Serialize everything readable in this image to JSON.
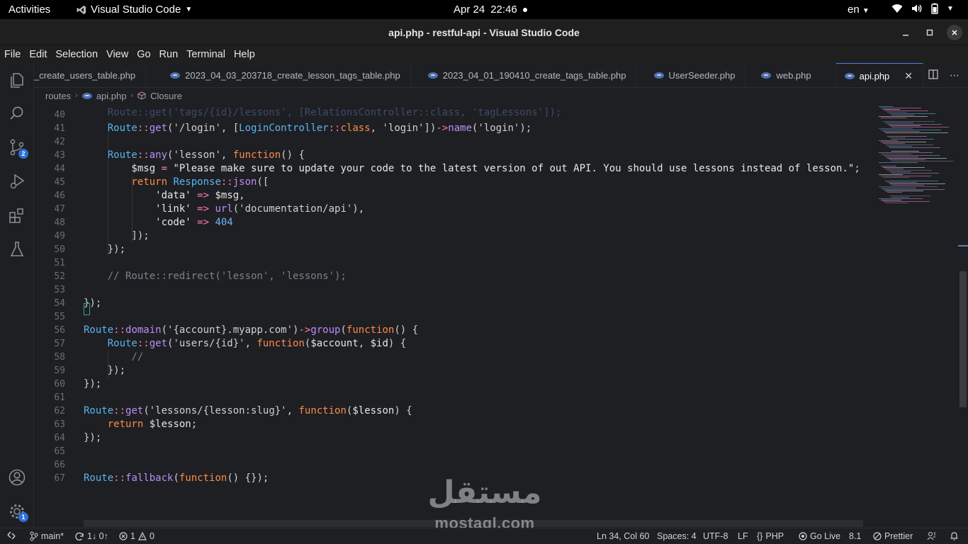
{
  "topbar": {
    "activities": "Activities",
    "app_name": "Visual Studio Code",
    "date": "Apr 24",
    "time": "22:46",
    "lang": "en"
  },
  "window": {
    "title": "api.php - restful-api - Visual Studio Code"
  },
  "menu": [
    "File",
    "Edit",
    "Selection",
    "View",
    "Go",
    "Run",
    "Terminal",
    "Help"
  ],
  "tabs": [
    {
      "label": "_create_users_table.php",
      "active": false,
      "icon": false
    },
    {
      "label": "2023_04_03_203718_create_lesson_tags_table.php",
      "active": false,
      "icon": true
    },
    {
      "label": "2023_04_01_190410_create_tags_table.php",
      "active": false,
      "icon": true
    },
    {
      "label": "UserSeeder.php",
      "active": false,
      "icon": true
    },
    {
      "label": "web.php",
      "active": false,
      "icon": true
    },
    {
      "label": "api.php",
      "active": true,
      "icon": true
    }
  ],
  "breadcrumb": {
    "folder": "routes",
    "file": "api.php",
    "symbol": "Closure"
  },
  "activity_badges": {
    "source_control": "2",
    "settings": "1"
  },
  "code_lines": [
    {
      "n": "40",
      "tokens": []
    },
    {
      "n": "41",
      "tokens": [
        [
          "t-class",
          "    Route"
        ],
        [
          "t-op",
          "::"
        ],
        [
          "t-fn",
          "get"
        ],
        [
          "t-p",
          "('/login', ["
        ],
        [
          "t-class",
          "LoginController"
        ],
        [
          "t-op",
          "::"
        ],
        [
          "t-kw",
          "class"
        ],
        [
          "t-p",
          ", 'login'])"
        ],
        [
          "t-op",
          "->"
        ],
        [
          "t-fn",
          "name"
        ],
        [
          "t-p",
          "('login');"
        ]
      ]
    },
    {
      "n": "42",
      "tokens": []
    },
    {
      "n": "43",
      "tokens": [
        [
          "t-class",
          "    Route"
        ],
        [
          "t-op",
          "::"
        ],
        [
          "t-fn",
          "any"
        ],
        [
          "t-p",
          "('lesson', "
        ],
        [
          "t-kw",
          "function"
        ],
        [
          "t-p",
          "() {"
        ]
      ]
    },
    {
      "n": "44",
      "tokens": [
        [
          "t-var",
          "        $msg "
        ],
        [
          "t-op",
          "="
        ],
        [
          "t-str",
          " \"Please make sure to update your code to the latest version of out API. You should use lessons instead of lesson.\""
        ],
        [
          "t-p",
          ";"
        ]
      ]
    },
    {
      "n": "45",
      "tokens": [
        [
          "t-kw",
          "        return "
        ],
        [
          "t-class",
          "Response"
        ],
        [
          "t-op",
          "::"
        ],
        [
          "t-fn",
          "json"
        ],
        [
          "t-p",
          "(["
        ]
      ]
    },
    {
      "n": "46",
      "tokens": [
        [
          "t-str",
          "            'data' "
        ],
        [
          "t-op",
          "=>"
        ],
        [
          "t-var",
          " $msg"
        ],
        [
          "t-p",
          ","
        ]
      ]
    },
    {
      "n": "47",
      "tokens": [
        [
          "t-str",
          "            'link' "
        ],
        [
          "t-op",
          "=>"
        ],
        [
          "t-fn",
          " url"
        ],
        [
          "t-p",
          "('documentation/api'),"
        ]
      ]
    },
    {
      "n": "48",
      "tokens": [
        [
          "t-str",
          "            'code' "
        ],
        [
          "t-op",
          "=>"
        ],
        [
          "t-num",
          " 404"
        ]
      ]
    },
    {
      "n": "49",
      "tokens": [
        [
          "t-p",
          "        ]);"
        ]
      ]
    },
    {
      "n": "50",
      "tokens": [
        [
          "t-p",
          "    });"
        ]
      ]
    },
    {
      "n": "51",
      "tokens": []
    },
    {
      "n": "52",
      "tokens": [
        [
          "t-cm",
          "    // Route::redirect('lesson', 'lessons');"
        ]
      ]
    },
    {
      "n": "53",
      "tokens": []
    },
    {
      "n": "54",
      "tokens": [
        [
          "t-p",
          "});"
        ]
      ]
    },
    {
      "n": "55",
      "tokens": []
    },
    {
      "n": "56",
      "tokens": [
        [
          "t-class",
          "Route"
        ],
        [
          "t-op",
          "::"
        ],
        [
          "t-fn",
          "domain"
        ],
        [
          "t-p",
          "('{account}.myapp.com')"
        ],
        [
          "t-op",
          "->"
        ],
        [
          "t-fn",
          "group"
        ],
        [
          "t-p",
          "("
        ],
        [
          "t-kw",
          "function"
        ],
        [
          "t-p",
          "() {"
        ]
      ]
    },
    {
      "n": "57",
      "tokens": [
        [
          "t-class",
          "    Route"
        ],
        [
          "t-op",
          "::"
        ],
        [
          "t-fn",
          "get"
        ],
        [
          "t-p",
          "('users/{id}', "
        ],
        [
          "t-kw",
          "function"
        ],
        [
          "t-p",
          "("
        ],
        [
          "t-var",
          "$account"
        ],
        [
          "t-p",
          ", "
        ],
        [
          "t-var",
          "$id"
        ],
        [
          "t-p",
          ") {"
        ]
      ]
    },
    {
      "n": "58",
      "tokens": [
        [
          "t-cm",
          "        //"
        ]
      ]
    },
    {
      "n": "59",
      "tokens": [
        [
          "t-p",
          "    });"
        ]
      ]
    },
    {
      "n": "60",
      "tokens": [
        [
          "t-p",
          "});"
        ]
      ]
    },
    {
      "n": "61",
      "tokens": []
    },
    {
      "n": "62",
      "tokens": [
        [
          "t-class",
          "Route"
        ],
        [
          "t-op",
          "::"
        ],
        [
          "t-fn",
          "get"
        ],
        [
          "t-p",
          "('lessons/{lesson:slug}', "
        ],
        [
          "t-kw",
          "function"
        ],
        [
          "t-p",
          "("
        ],
        [
          "t-var",
          "$lesson"
        ],
        [
          "t-p",
          ") {"
        ]
      ]
    },
    {
      "n": "63",
      "tokens": [
        [
          "t-kw",
          "    return "
        ],
        [
          "t-var",
          "$lesson"
        ],
        [
          "t-p",
          ";"
        ]
      ]
    },
    {
      "n": "64",
      "tokens": [
        [
          "t-p",
          "});"
        ]
      ]
    },
    {
      "n": "65",
      "tokens": []
    },
    {
      "n": "66",
      "tokens": []
    },
    {
      "n": "67",
      "tokens": [
        [
          "t-class",
          "Route"
        ],
        [
          "t-op",
          "::"
        ],
        [
          "t-fn",
          "fallback"
        ],
        [
          "t-p",
          "("
        ],
        [
          "t-kw",
          "function"
        ],
        [
          "t-p",
          "() {});"
        ]
      ]
    }
  ],
  "watermark": {
    "arabic": "مستقل",
    "latin": "mostaql.com"
  },
  "statusbar": {
    "branch": "main*",
    "sync": "1↓ 0↑",
    "errors": "1",
    "warnings": "0",
    "position": "Ln 34, Col 60",
    "spaces": "Spaces: 4",
    "encoding": "UTF-8",
    "eol": "LF",
    "language": "PHP",
    "golive": "Go Live",
    "php_version": "8.1",
    "prettier": "Prettier"
  },
  "colors": {
    "accent": "#4e7fd8",
    "badge": "#2f6fd8"
  }
}
